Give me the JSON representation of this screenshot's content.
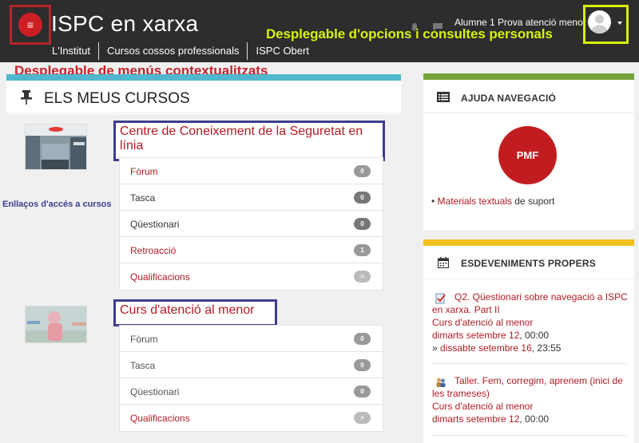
{
  "header": {
    "menu_icon": "hamburger-icon",
    "site_title": "ISPC en xarxa",
    "nav": [
      "L'Institut",
      "Cursos cossos professionals",
      "ISPC Obert"
    ],
    "user_name": "Alumne 1 Prova atenció menor",
    "annotation_user": "Desplegable d'opcions i consultes personals"
  },
  "annotation_context": "Desplegable de menús contextualitzats",
  "annotation_access": "Enllaços d'accés a cursos",
  "courses": {
    "title": "ELS MEUS CURSOS",
    "items": [
      {
        "title": "Centre de Coneixement de la Seguretat en línia",
        "activities": [
          {
            "label": "Fòrum",
            "count": "0",
            "link": true
          },
          {
            "label": "Tasca",
            "count": "0",
            "link": false
          },
          {
            "label": "Qüestionari",
            "count": "0",
            "link": false
          },
          {
            "label": "Retroacció",
            "count": "1",
            "link": true
          },
          {
            "label": "Qualificacions",
            "count": ">",
            "link": true
          }
        ]
      },
      {
        "title": "Curs d'atenció al menor",
        "activities": [
          {
            "label": "Fòrum",
            "count": "0",
            "link": false
          },
          {
            "label": "Tasca",
            "count": "0",
            "link": false
          },
          {
            "label": "Qüestionari",
            "count": "0",
            "link": false
          },
          {
            "label": "Qualificacions",
            "count": ">",
            "link": true
          }
        ]
      }
    ]
  },
  "nav_help": {
    "title": "AJUDA NAVEGACIÓ",
    "pmf_label": "PMF",
    "bullet": "•",
    "materials_link": "Materials textuals",
    "materials_suffix": " de suport"
  },
  "events": {
    "title": "ESDEVENIMENTS PROPERS",
    "items": [
      {
        "title": "Q2. Qüestionari sobre navegació a ISPC en xarxa. Part II",
        "course": "Curs d'atenció al menor",
        "date1": "dimarts setembre 12",
        "time1": ", 00:00",
        "prefix2": "» ",
        "date2": "dissabte setembre 16",
        "time2": ", 23:55"
      },
      {
        "title": "Taller. Fem, corregim, aprenem (inici de les trameses)",
        "course": "Curs d'atenció al menor",
        "date1": "dimarts setembre 12",
        "time1": ", 00:00"
      }
    ]
  },
  "colors": {
    "header_bg": "#2d2d2d",
    "accent_red": "#cc1f24",
    "courses_bar": "#4fb8cf",
    "nav_bar": "#74a43a",
    "events_bar": "#f2c21a",
    "annotation_yellow": "#d7f10a",
    "annotation_blue": "#3d3d8f"
  }
}
